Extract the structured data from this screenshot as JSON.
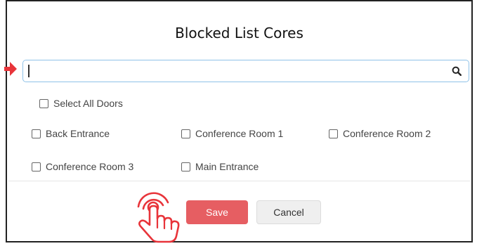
{
  "dialog": {
    "title": "Blocked List Cores"
  },
  "search": {
    "value": "",
    "placeholder": ""
  },
  "select_all": {
    "label": "Select All Doors",
    "checked": false
  },
  "doors": [
    {
      "label": "Back Entrance",
      "checked": false
    },
    {
      "label": "Conference Room 1",
      "checked": false
    },
    {
      "label": "Conference Room 2",
      "checked": false
    },
    {
      "label": "Conference Room 3",
      "checked": false
    },
    {
      "label": "Main Entrance",
      "checked": false
    }
  ],
  "buttons": {
    "save_label": "Save",
    "cancel_label": "Cancel"
  },
  "icons": {
    "search": "search-icon",
    "arrow": "arrow-right-icon",
    "hand": "tap-hand-icon"
  },
  "colors": {
    "save_bg": "#e65e62",
    "arrow": "#e8343a",
    "focus_border": "#8fc2e8"
  }
}
